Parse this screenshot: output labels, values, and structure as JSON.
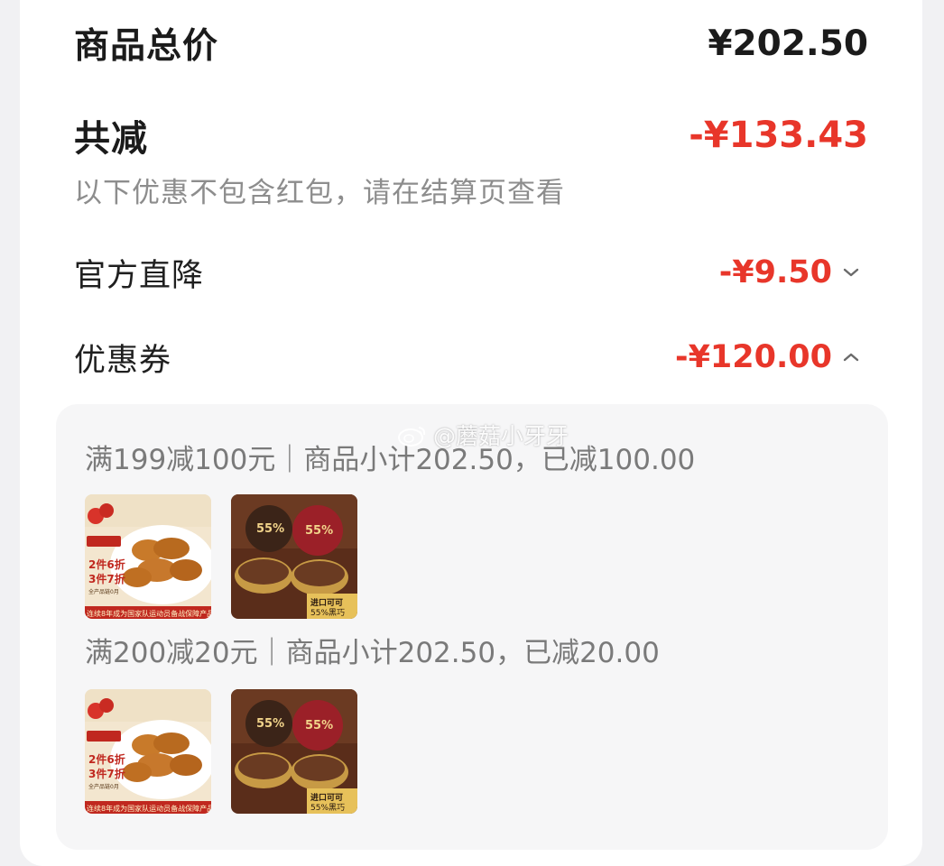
{
  "summary": {
    "total_label": "商品总价",
    "total_value": "¥202.50",
    "reduce_label": "共减",
    "reduce_value": "-¥133.43",
    "note": "以下优惠不包含红包，请在结算页查看"
  },
  "lines": {
    "official_label": "官方直降",
    "official_value": "-¥9.50",
    "coupon_label": "优惠券",
    "coupon_value": "-¥120.00"
  },
  "coupons": [
    {
      "title": "满199减100元｜商品小计202.50，已减100.00",
      "product1": {
        "badge": "2件6折",
        "badge2": "3件7折",
        "small": "全产品链0月",
        "bottom": "连续8年成为国家队运动员备战保障产品"
      },
      "product2": {
        "label1": "55%",
        "label2": "55%",
        "bottom1": "进口可可",
        "bottom2": "55%黑巧"
      }
    },
    {
      "title": "满200减20元｜商品小计202.50，已减20.00",
      "product1": {
        "badge": "2件6折",
        "badge2": "3件7折",
        "small": "全产品链0月",
        "bottom": "连续8年成为国家队运动员备战保障产品"
      },
      "product2": {
        "label1": "55%",
        "label2": "55%",
        "bottom1": "进口可可",
        "bottom2": "55%黑巧"
      }
    }
  ],
  "watermark": {
    "text": "@蘑菇小牙牙",
    "icon": "weibo-icon"
  },
  "colors": {
    "accent_red": "#e8362a",
    "text_dark": "#1b1b1b",
    "text_muted": "#8d8d8d",
    "panel_bg": "#f6f6f7"
  }
}
